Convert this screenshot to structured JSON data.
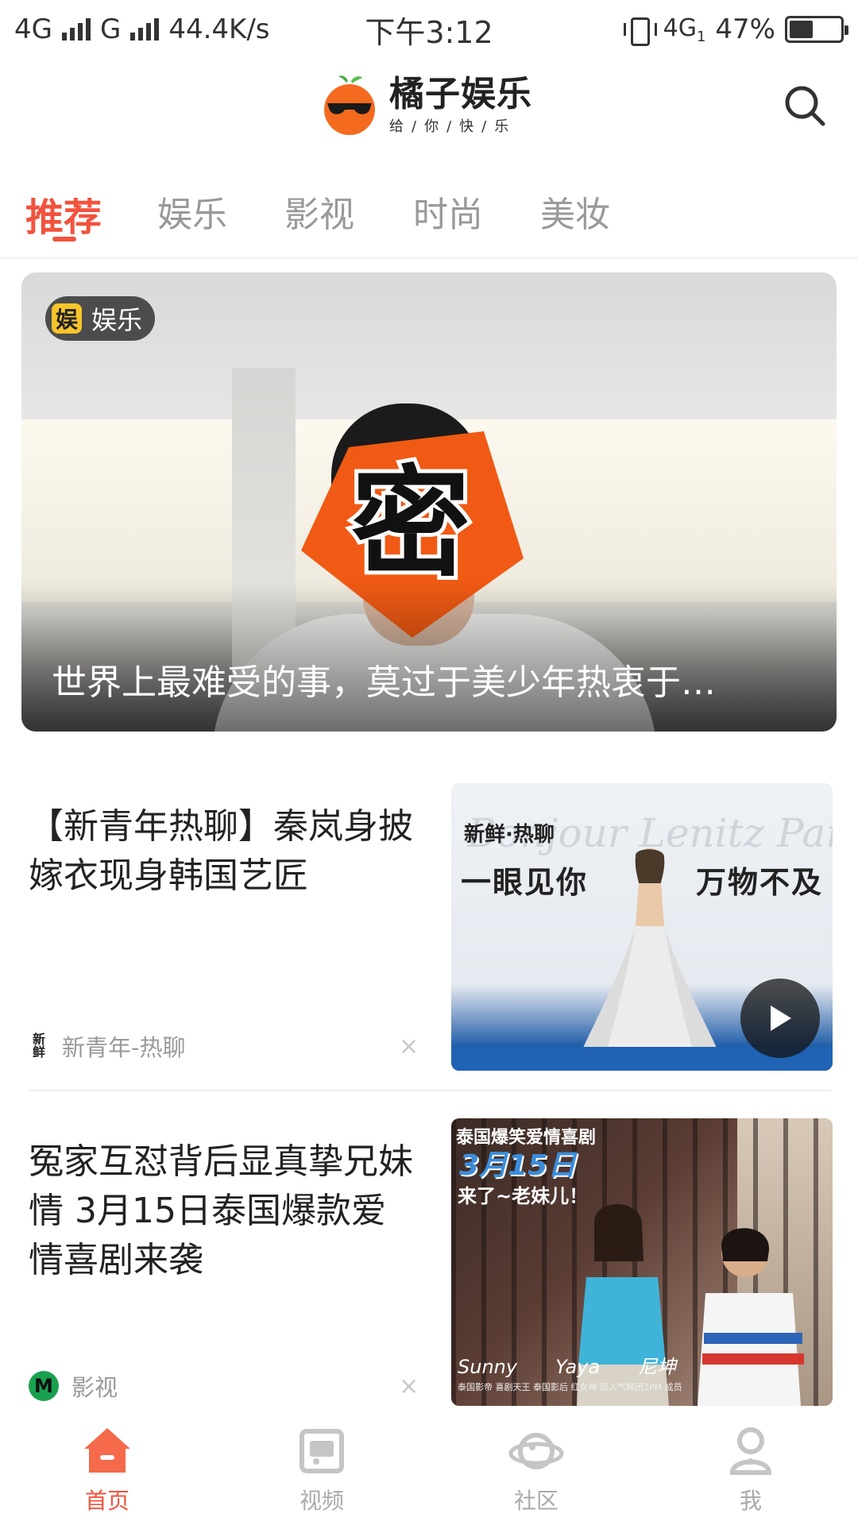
{
  "status_bar": {
    "network1": "4G",
    "network2": "G",
    "speed": "44.4K/s",
    "time": "下午3:12",
    "network3": "4G",
    "network3_sub": "1",
    "battery": "47%",
    "battery_level": 0.47
  },
  "header": {
    "logo_title": "橘子娱乐",
    "logo_slogan": "给/你/快/乐"
  },
  "tabs": [
    {
      "label": "推荐",
      "active": true
    },
    {
      "label": "娱乐",
      "active": false
    },
    {
      "label": "影视",
      "active": false
    },
    {
      "label": "时尚",
      "active": false
    },
    {
      "label": "美妆",
      "active": false
    }
  ],
  "hero": {
    "badge_icon_text": "娱",
    "badge_label": "娱乐",
    "censor_text": "密",
    "title": "世界上最难受的事，莫过于美少年热衷于…"
  },
  "news": [
    {
      "title": "【新青年热聊】秦岚身披嫁衣现身韩国艺匠",
      "source_icon_text": "新鲜",
      "source": "新青年-热聊",
      "close": "×",
      "thumb": {
        "script": "Bonjour Lenitz Paris",
        "brand": "新鲜·热聊",
        "left_slogan": "一眼见你",
        "right_slogan": "万物不及"
      }
    },
    {
      "title": "冤家互怼背后显真挚兄妹情 3月15日泰国爆款爱情喜剧来袭",
      "source_icon_text": "M",
      "source": "影视",
      "close": "×",
      "thumb": {
        "top_text": "泰国爆笑爱情喜剧",
        "date": "3月15日",
        "sub": "来了~老妹儿！",
        "names": [
          "Sunny",
          "Yaya",
          "尼坤"
        ],
        "credits": "泰国影帝 喜剧天王    泰国影后 红女神    超人气韩团2PM 成员"
      }
    }
  ],
  "bottom_nav": [
    {
      "label": "首页",
      "icon": "home-icon",
      "active": true
    },
    {
      "label": "视频",
      "icon": "video-icon",
      "active": false
    },
    {
      "label": "社区",
      "icon": "community-icon",
      "active": false
    },
    {
      "label": "我",
      "icon": "profile-icon",
      "active": false
    }
  ],
  "colors": {
    "accent": "#f2533e",
    "inactive": "#999999",
    "logo_orange": "#f46a1f"
  }
}
